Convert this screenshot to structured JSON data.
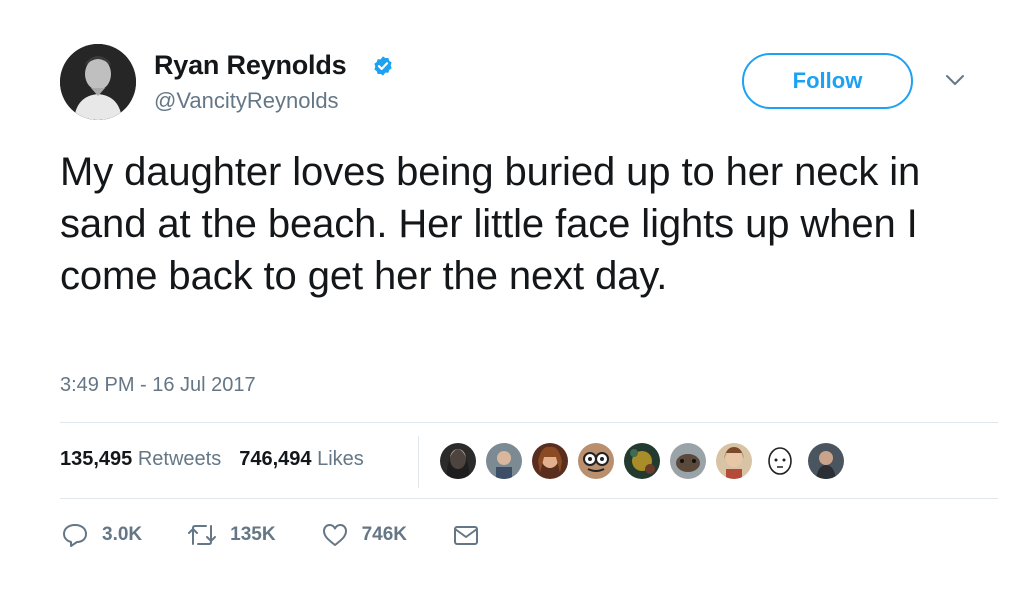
{
  "author": {
    "name": "Ryan Reynolds",
    "handle": "@VancityReynolds",
    "verified": true
  },
  "follow_button": {
    "label": "Follow"
  },
  "tweet": {
    "text": "My daughter loves being buried up to her neck in sand at the beach. Her little face lights up when I come back to get her the next day.",
    "timestamp": "3:49 PM - 16 Jul 2017"
  },
  "stats": {
    "retweets_count": "135,495",
    "retweets_label": "Retweets",
    "likes_count": "746,494",
    "likes_label": "Likes"
  },
  "actions": {
    "reply_count": "3.0K",
    "retweet_count": "135K",
    "like_count": "746K"
  },
  "colors": {
    "accent": "#1da1f2",
    "text": "#14171a",
    "secondary_text": "#657786",
    "divider": "#e1e8ed"
  },
  "icons": [
    "verified-badge-icon",
    "chevron-down-icon",
    "reply-icon",
    "retweet-icon",
    "heart-icon",
    "envelope-icon"
  ]
}
